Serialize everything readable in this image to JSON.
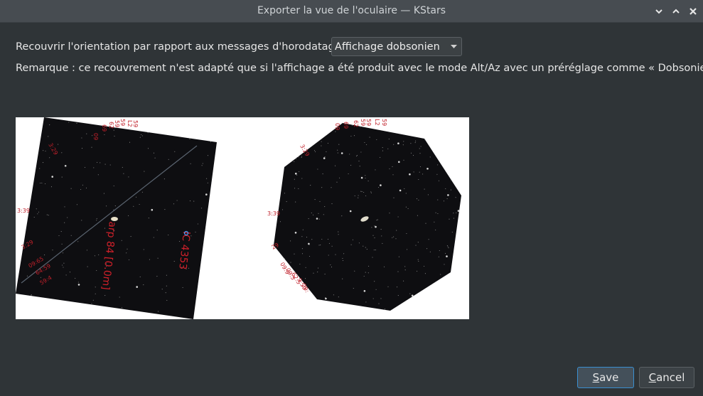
{
  "window": {
    "title": "Exporter la vue de l'oculaire — KStars",
    "controls": [
      "chevron-down-icon",
      "chevron-up-icon",
      "close-icon"
    ]
  },
  "orientation": {
    "label": "Recouvrir l'orientation par rapport aux messages d'horodatage",
    "selected": "Affichage dobsonien"
  },
  "remark": "Remarque : ce recouvrement n'est adapté que si l'affichage a été produit avec le mode Alt/Az avec un préréglage comme « Dobsonien ».",
  "preview": {
    "left_labels": {
      "object": "arp 84 [0.0m]",
      "neighbor": "IC 4353"
    }
  },
  "buttons": {
    "save_mnemonic": "S",
    "save_rest": "ave",
    "cancel_mnemonic": "C",
    "cancel_rest": "ancel"
  },
  "colors": {
    "background": "#2f3437",
    "titlebar": "#474c51",
    "accent": "#3a8fd0",
    "overlay_red": "#d0202a"
  }
}
